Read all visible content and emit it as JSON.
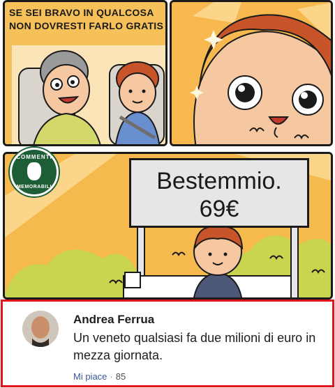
{
  "comic": {
    "caption": [
      "SE SEI BRAVO IN QUALCOSA",
      "NON DOVRESTI FARLO GRATIS"
    ],
    "sign": [
      "Bestemmio.",
      "69€"
    ]
  },
  "badge": {
    "top_text": "COMMENTI",
    "bottom_text": "MEMORABILI"
  },
  "comment": {
    "author": "Andrea Ferrua",
    "text": "Un veneto qualsiasi fa due milioni di euro in mezza giornata.",
    "like_label": "Mi piace",
    "separator": "·",
    "reaction_count": "85"
  },
  "colors": {
    "comic_bg": "#f7c15a",
    "frame_border": "#e0141c",
    "link_blue": "#385898",
    "badge_green": "#1e5e36"
  }
}
